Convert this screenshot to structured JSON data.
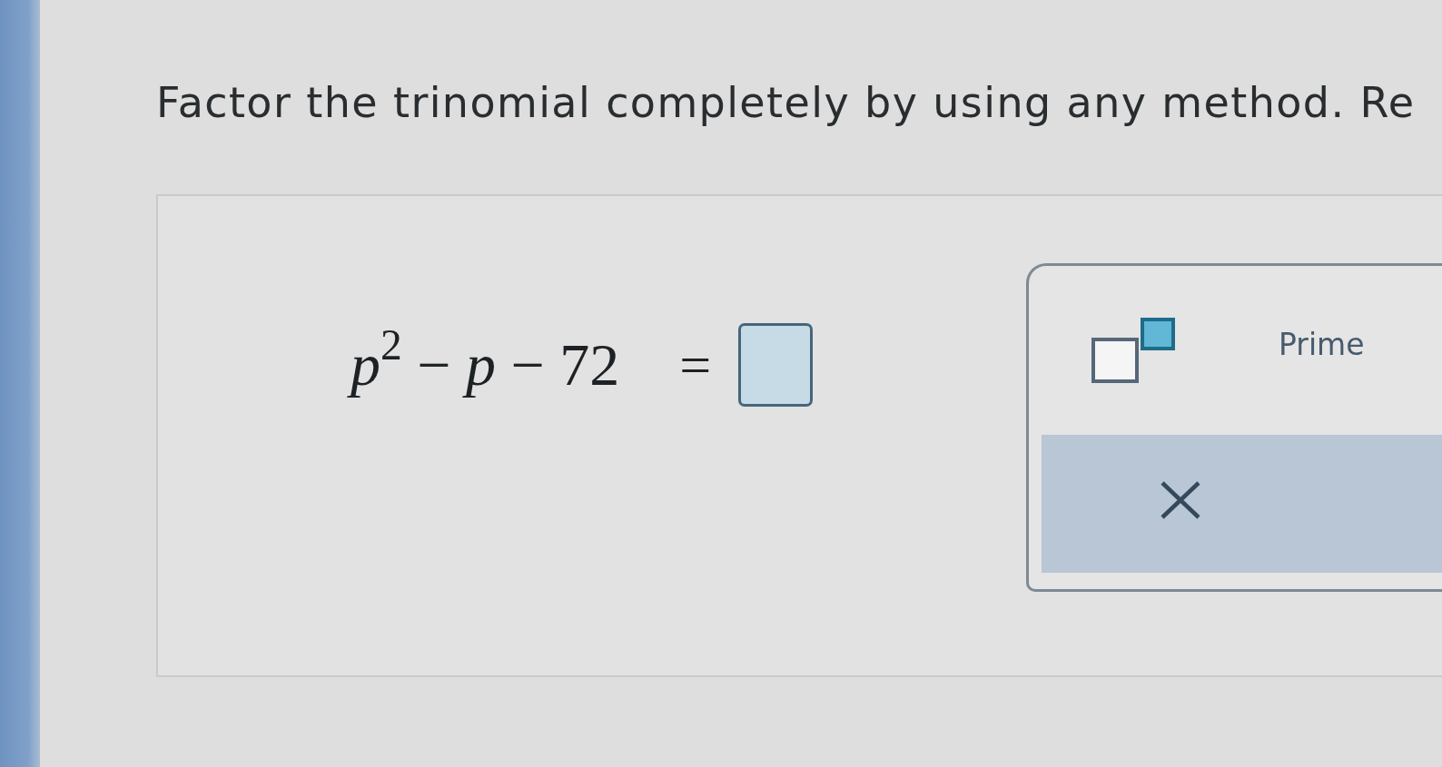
{
  "question": {
    "text": "Factor the trinomial completely by using any method. Re"
  },
  "problem": {
    "expression": "*p*$^{2}$ − *p* − 72",
    "equals": "=",
    "answer": {
      "focused": true
    }
  },
  "palette": {
    "tools": [
      {
        "kind": "exponent"
      },
      {
        "kind": "text",
        "label": "Prime"
      }
    ],
    "actions": [
      {
        "kind": "clear"
      }
    ]
  }
}
